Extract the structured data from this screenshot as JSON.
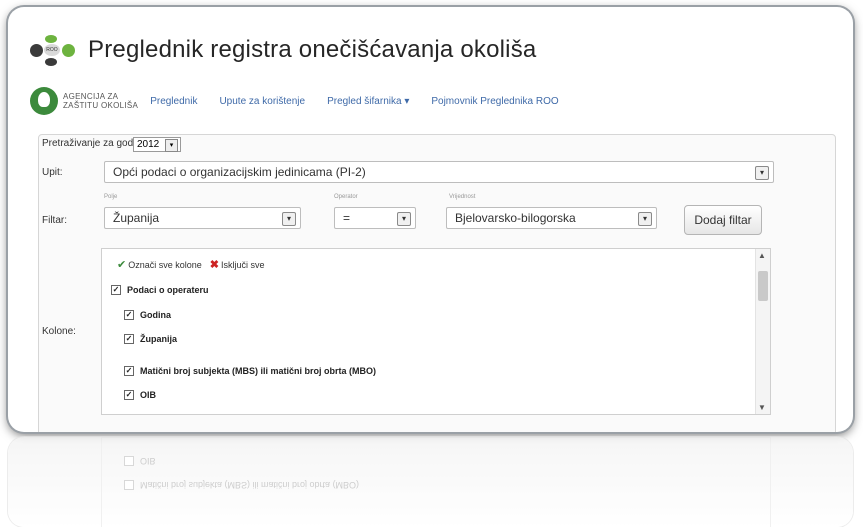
{
  "header": {
    "title": "Preglednik registra onečišćavanja okoliša",
    "logo_text": "ROO"
  },
  "nav": {
    "agency_line1": "AGENCIJA ZA",
    "agency_line2": "ZAŠTITU OKOLIŠA",
    "links": [
      "Preglednik",
      "Upute za korištenje",
      "Pregled šifarnika ▾",
      "Pojmovnik Preglednika ROO"
    ]
  },
  "search": {
    "year_label": "Pretraživanje za godinu",
    "year_value": "2012",
    "query_label": "Upit:",
    "query_value": "Opći podaci o organizacijskim jedinicama (PI-2)",
    "filter_label": "Filtar:",
    "field_caption": "Polje",
    "field_value": "Županija",
    "operator_caption": "Operator",
    "operator_value": "=",
    "value_caption": "Vrijednost",
    "value_value": "Bjelovarsko-bilogorska",
    "add_filter": "Dodaj filtar",
    "columns_label": "Kolone:"
  },
  "columns": {
    "select_all": "Označi sve kolone",
    "deselect_all": "Isključi sve",
    "group": "Podaci o operateru",
    "items": [
      "Godina",
      "Županija",
      "Matični broj subjekta (MBS) ili matični broj obrta (MBO)",
      "OIB"
    ]
  },
  "colors": {
    "link": "#3f6aa8",
    "green": "#3c8a3c",
    "red": "#cc2222"
  }
}
